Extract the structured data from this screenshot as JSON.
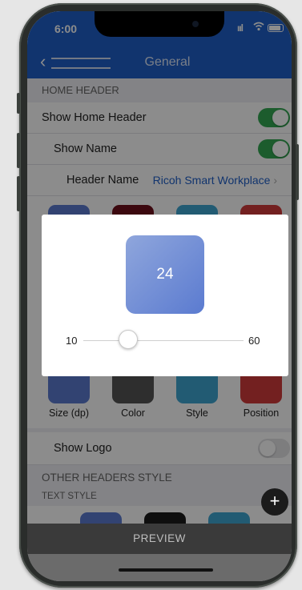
{
  "status_bar": {
    "time": "6:00",
    "signal": "ııl"
  },
  "navbar": {
    "back_glyph": "‹",
    "title": "General"
  },
  "sections": {
    "home_header": "HOME HEADER",
    "other_headers_style": "OTHER HEADERS STYLE",
    "text_style": "TEXT STYLE"
  },
  "rows": {
    "show_home_header": {
      "label": "Show Home Header",
      "toggle": "on"
    },
    "show_name": {
      "label": "Show Name",
      "toggle": "on"
    },
    "header_name": {
      "label": "Header Name",
      "value": "Ricoh Smart Workplace",
      "chevron": "›"
    },
    "show_logo": {
      "label": "Show Logo",
      "toggle": "off"
    }
  },
  "style_tiles": [
    {
      "label": "Size (dp)",
      "color": "#5b7bd0"
    },
    {
      "label": "Color",
      "color": "#6e0f1c"
    },
    {
      "label": "Style",
      "color": "#3fa6d2"
    },
    {
      "label": "Position",
      "color": "#d23b3b"
    }
  ],
  "text_style_tiles": [
    {
      "color": "#5b7bd0"
    },
    {
      "color": "#1b1b1b"
    },
    {
      "color": "#3fa6d2"
    }
  ],
  "dialog": {
    "preview_value": "24",
    "slider_min": "10",
    "slider_max": "60",
    "slider_value": 24
  },
  "fab": {
    "glyph": "+"
  },
  "preview_button": {
    "label": "PREVIEW"
  },
  "colors": {
    "accent": "#1f5fc8",
    "toggle_on": "#34a853"
  }
}
